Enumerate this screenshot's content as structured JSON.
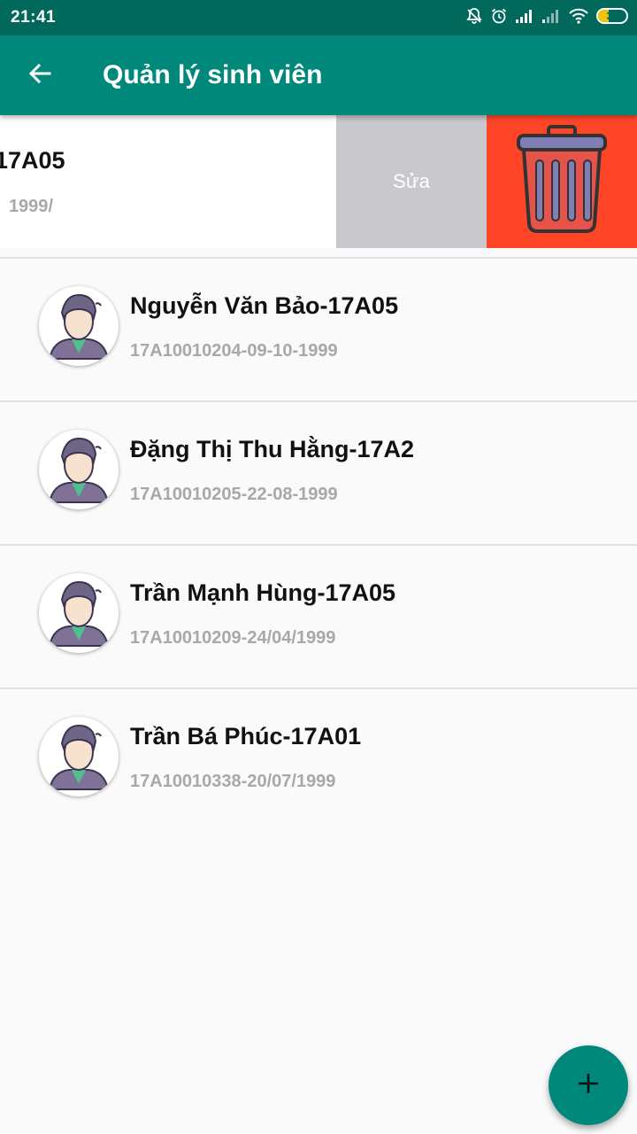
{
  "status_bar": {
    "time": "21:41",
    "battery_level": "37",
    "icons": [
      "bell-off-icon",
      "alarm-icon",
      "signal-icon",
      "signal-weak-icon",
      "wifi-icon",
      "battery-icon"
    ]
  },
  "app_bar": {
    "title": "Quản lý sinh viên",
    "back_icon": "arrow-left-icon"
  },
  "swiped_row": {
    "name_visible": "17A05",
    "sub_visible": "/1999",
    "edit_label": "Sửa",
    "delete_icon": "trash-icon"
  },
  "students": [
    {
      "name": "Nguyễn Văn Bảo-17A05",
      "info": "17A10010204-09-10-1999"
    },
    {
      "name": "Đặng Thị Thu Hằng-17A2",
      "info": "17A10010205-22-08-1999"
    },
    {
      "name": "Trần Mạnh Hùng-17A05",
      "info": "17A10010209-24/04/1999"
    },
    {
      "name": "Trần Bá Phúc-17A01",
      "info": "17A10010338-20/07/1999"
    }
  ],
  "fab": {
    "icon": "plus-icon"
  },
  "colors": {
    "status_bar": "#00695c",
    "app_bar": "#00897b",
    "edit_action": "#c8c8cd",
    "delete_action": "#ff4528",
    "fab": "#00897b"
  }
}
